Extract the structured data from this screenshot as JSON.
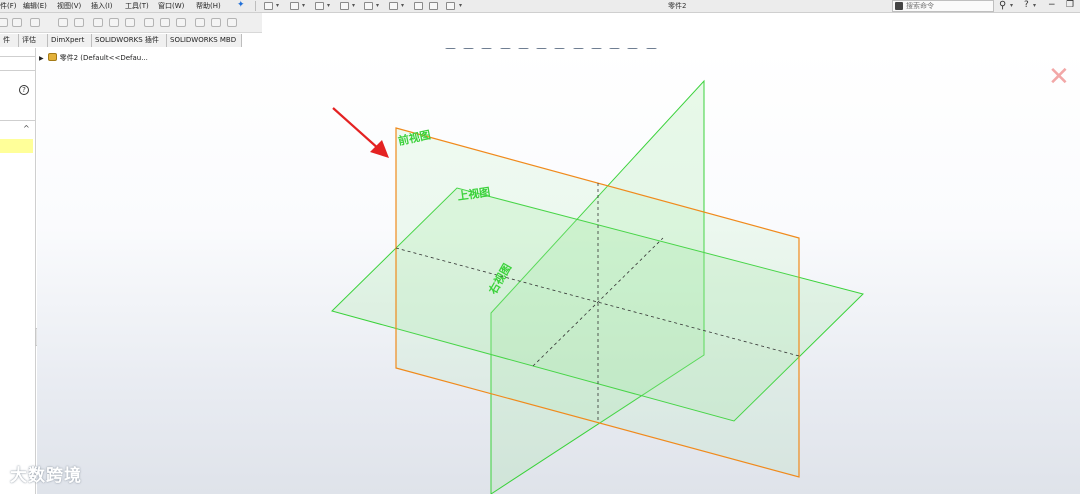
{
  "menu": {
    "items": [
      "件(F)",
      "编辑(E)",
      "视图(V)",
      "插入(I)",
      "工具(T)",
      "窗口(W)",
      "帮助(H)"
    ]
  },
  "document_title": "零件2",
  "search": {
    "placeholder": "搜索命令"
  },
  "window_controls": {
    "help": "?",
    "minimize": "−",
    "restore": "❐"
  },
  "tabs": [
    "件",
    "评估",
    "DimXpert",
    "SOLIDWORKS 插件",
    "SOLIDWORKS MBD"
  ],
  "feature_tree": {
    "root_label": "零件2  (Default<<Defau..."
  },
  "planes": {
    "front": "前视图",
    "top": "上视图",
    "right": "右视图"
  },
  "colors": {
    "front_plane_edge": "#f08a1c",
    "plane_edge": "#3bd23b",
    "plane_fill": "#9be89b",
    "arrow": "#e42222",
    "close_x": "#f2a7a7"
  },
  "watermark": {
    "text": "大数跨境"
  }
}
